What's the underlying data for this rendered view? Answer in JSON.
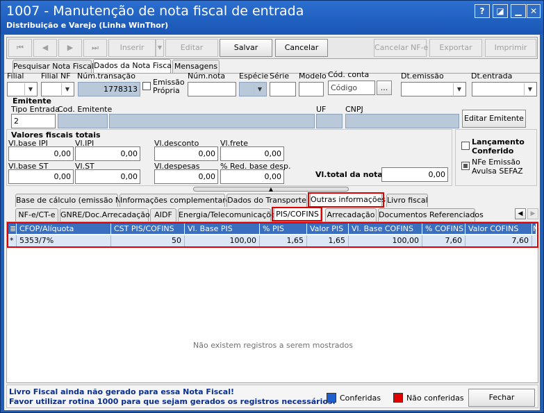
{
  "window": {
    "title": "1007 - Manutenção de nota fiscal de entrada",
    "subtitle": "Distribuição e Varejo (Linha WinThor)",
    "help": "?",
    "close": "✕"
  },
  "toolbar": {
    "first": "⏮",
    "prev": "◀",
    "next": "▶",
    "last": "⏭",
    "inserir": "Inserir",
    "editar": "Editar",
    "salvar": "Salvar",
    "cancelar": "Cancelar",
    "cancelar_nfe": "Cancelar NF-e",
    "exportar": "Exportar",
    "imprimir": "Imprimir"
  },
  "main_tabs": [
    "Pesquisar Nota Fiscal",
    "Dados da Nota Fiscal",
    "Mensagens"
  ],
  "header_fields": {
    "filial_label": "Filial",
    "filial_nf_label": "Filial NF",
    "num_transacao_label": "Núm.transação",
    "num_transacao_value": "1778313",
    "emissao_propria_label": "Emissão Própria",
    "num_nota_label": "Núm.nota",
    "especie_label": "Espécie",
    "serie_label": "Série",
    "modelo_label": "Modelo",
    "cod_conta_label": "Cód. conta",
    "cod_conta_placeholder": "Código",
    "dt_emissao_label": "Dt.emissão",
    "dt_entrada_label": "Dt.entrada",
    "ellipsis": "..."
  },
  "emitente": {
    "section": "Emitente",
    "tipo_entrada_label": "Tipo Entrada",
    "tipo_entrada_value": "2",
    "cod_emitente_label": "Cod. Emitente",
    "uf_label": "UF",
    "cnpj_label": "CNPJ",
    "editar_button": "Editar Emitente"
  },
  "valores": {
    "section": "Valores fiscais totais",
    "base_ipi_label": "Vl.base IPI",
    "base_ipi": "0,00",
    "ipi_label": "Vl.IPI",
    "ipi": "0,00",
    "desconto_label": "Vl.desconto",
    "desconto": "0,00",
    "frete_label": "Vl.frete",
    "frete": "0,00",
    "base_st_label": "Vl.base ST",
    "base_st": "0,00",
    "st_label": "Vl.ST",
    "st": "0,00",
    "despesas_label": "Vl.despesas",
    "despesas": "0,00",
    "red_base_label": "% Red. base desp.",
    "red_base": "0,00",
    "total_label": "Vl.total da nota:",
    "total": "0,00"
  },
  "side_checks": {
    "lancamento": "Lançamento Conferido",
    "nfe_emissao": "NFe Emissão Avulsa SEFAZ"
  },
  "sub_tabs_1": [
    "Base de cálculo (emissão NF)",
    "Informações complementares",
    "Dados do Transporte",
    "Outras informações",
    "Livro fiscal"
  ],
  "sub_tabs_2": [
    "NF-e/CT-e",
    "GNRE/Doc.Arrecadação",
    "AIDF",
    "Energia/Telecomunicações",
    "PIS/COFINS",
    "Arrecadação",
    "Documentos Referenciados"
  ],
  "grid": {
    "columns": [
      "CFOP/Alíquota",
      "CST PIS/COFINS",
      "Vl. Base PIS",
      "% PIS",
      "Valor PIS",
      "Vl. Base COFINS",
      "% COFINS",
      "Valor COFINS",
      "M"
    ],
    "row": [
      "5353/7%",
      "50",
      "100,00",
      "1,65",
      "1,65",
      "100,00",
      "7,60",
      "7,60"
    ],
    "row_marker": "*",
    "empty_message": "Não existem registros a serem mostrados"
  },
  "footer": {
    "warning_line1": "Livro Fiscal ainda não gerado para essa Nota Fiscal!",
    "warning_line2": "Favor utilizar rotina 1000 para que sejam gerados os registros necessários.",
    "conferidas": "Conferidas",
    "nao_conferidas": "Não conferidas",
    "fechar": "Fechar"
  },
  "colors": {
    "title_blue": "#1a56b4",
    "grid_header": "#3a6fc0",
    "conferidas": "#1f5fd0",
    "nao_conferidas": "#e00000",
    "highlight": "#e00000"
  }
}
